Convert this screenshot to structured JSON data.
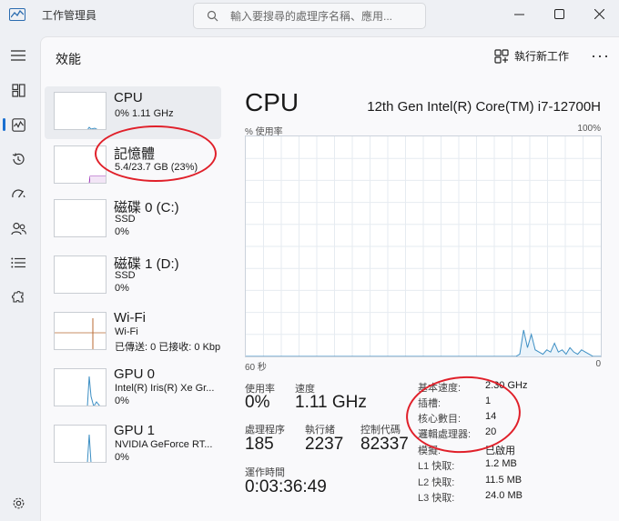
{
  "app": {
    "title": "工作管理員"
  },
  "search": {
    "placeholder": "輸入要搜尋的處理序名稱、應用..."
  },
  "header": {
    "title": "效能",
    "run_task_label": "執行新工作"
  },
  "devices": [
    {
      "title": "CPU",
      "line1": "0% 1.11 GHz",
      "line2": ""
    },
    {
      "title": "記憶體",
      "line1": "5.4/23.7 GB (23%)",
      "line2": ""
    },
    {
      "title": "磁碟 0 (C:)",
      "line1": "SSD",
      "line2": "0%"
    },
    {
      "title": "磁碟 1 (D:)",
      "line1": "SSD",
      "line2": "0%"
    },
    {
      "title": "Wi-Fi",
      "line1": "Wi-Fi",
      "line2": "已傳送: 0 已接收: 0 Kbp"
    },
    {
      "title": "GPU 0",
      "line1": "Intel(R) Iris(R) Xe Gr...",
      "line2": "0%"
    },
    {
      "title": "GPU 1",
      "line1": "NVIDIA GeForce RT...",
      "line2": "0%"
    }
  ],
  "cpu": {
    "title": "CPU",
    "model": "12th Gen Intel(R) Core(TM) i7-12700H",
    "graph_label_left": "% 使用率",
    "graph_label_right": "100%",
    "graph_time_left": "60 秒",
    "graph_time_right": "0",
    "usage_graph": [
      0,
      0,
      0,
      0,
      0,
      0,
      0,
      0,
      0,
      0,
      0,
      0,
      0,
      0,
      0,
      0,
      0,
      0,
      0,
      0,
      0,
      0,
      0,
      0,
      0,
      0,
      0,
      0,
      0,
      0,
      0,
      0,
      0,
      0,
      0,
      0,
      0,
      0,
      0,
      0,
      0,
      0,
      0,
      0,
      0,
      0,
      0,
      0,
      0,
      0,
      0,
      0,
      0,
      0,
      0,
      0,
      0,
      0,
      0,
      0,
      0,
      0,
      0,
      0,
      0,
      0,
      0,
      0,
      0,
      0,
      0,
      1,
      12,
      4,
      10,
      3,
      2,
      1,
      3,
      2,
      6,
      2,
      3,
      1,
      4,
      2,
      1,
      3,
      2,
      1,
      0,
      0,
      0
    ],
    "stats": {
      "usage_label": "使用率",
      "usage_value": "0%",
      "speed_label": "速度",
      "speed_value": "1.11 GHz",
      "processes_label": "處理程序",
      "processes_value": "185",
      "threads_label": "執行緒",
      "threads_value": "2237",
      "handles_label": "控制代碼",
      "handles_value": "82337",
      "uptime_label": "運作時間",
      "uptime_value": "0:03:36:49"
    },
    "details": [
      {
        "key": "基本速度:",
        "value": "2.30 GHz"
      },
      {
        "key": "插槽:",
        "value": "1"
      },
      {
        "key": "核心數目:",
        "value": "14"
      },
      {
        "key": "邏輯處理器:",
        "value": "20"
      },
      {
        "key": "模擬:",
        "value": "已啟用"
      },
      {
        "key": "L1 快取:",
        "value": "1.2 MB"
      },
      {
        "key": "L2 快取:",
        "value": "11.5 MB"
      },
      {
        "key": "L3 快取:",
        "value": "24.0 MB"
      }
    ]
  },
  "colors": {
    "cpu_line": "#3d8fc4",
    "memory_line": "#9a2fb5",
    "wifi_line": "#b86a32",
    "gpu_line": "#3d8fc4",
    "annotation": "#e0202a"
  }
}
